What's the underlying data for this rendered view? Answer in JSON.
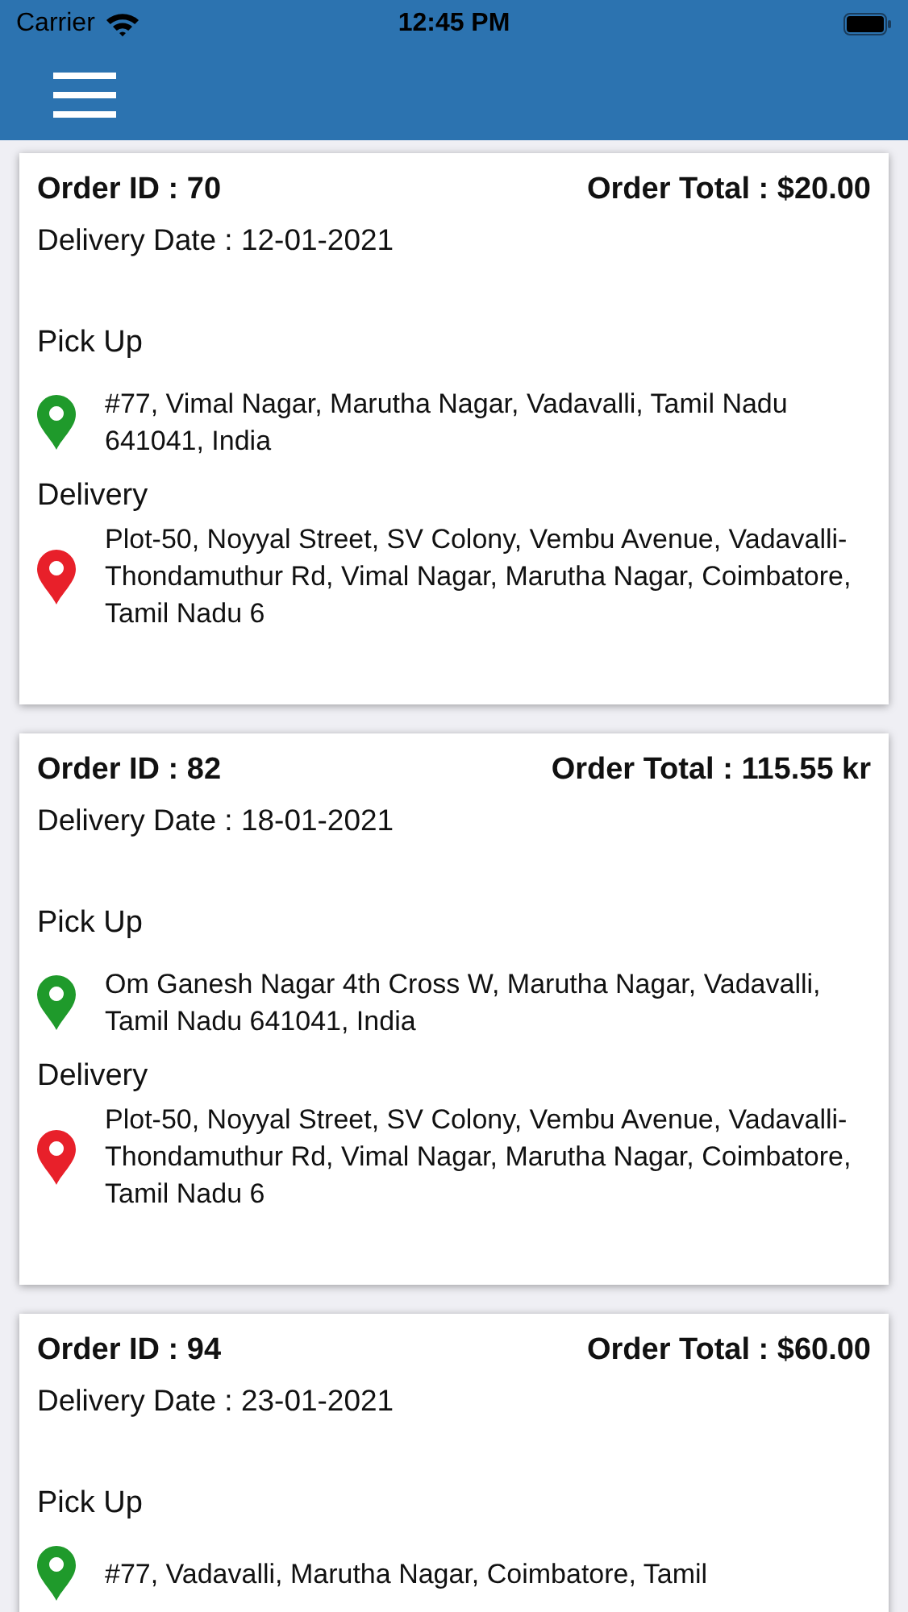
{
  "status_bar": {
    "carrier": "Carrier",
    "time": "12:45 PM"
  },
  "orders": [
    {
      "order_id": "Order ID : 70",
      "total": "Order Total : $20.00",
      "delivery_date": "Delivery Date : 12-01-2021",
      "locations": [
        {
          "kind": "pickup",
          "label": "Pick Up",
          "address": "#77, Vimal Nagar, Marutha Nagar, Vadavalli, Tamil Nadu 641041, India"
        },
        {
          "kind": "delivery",
          "label": "Delivery",
          "address": "Plot-50, Noyyal Street, SV Colony, Vembu Avenue, Vadavalli-Thondamuthur Rd, Vimal Nagar, Marutha Nagar, Coimbatore, Tamil Nadu 6"
        }
      ]
    },
    {
      "order_id": "Order ID : 82",
      "total": "Order Total : 115.55 kr",
      "delivery_date": "Delivery Date : 18-01-2021",
      "locations": [
        {
          "kind": "pickup",
          "label": "Pick Up",
          "address": "Om Ganesh Nagar 4th Cross W, Marutha Nagar, Vadavalli, Tamil Nadu 641041, India"
        },
        {
          "kind": "delivery",
          "label": "Delivery",
          "address": "Plot-50, Noyyal Street, SV Colony, Vembu Avenue, Vadavalli-Thondamuthur Rd, Vimal Nagar, Marutha Nagar, Coimbatore, Tamil Nadu 6"
        }
      ]
    },
    {
      "order_id": "Order ID : 94",
      "total": "Order Total : $60.00",
      "delivery_date": "Delivery Date : 23-01-2021",
      "locations": [
        {
          "kind": "pickup",
          "label": "Pick Up",
          "address": "#77, Vadavalli, Marutha Nagar, Coimbatore, Tamil"
        }
      ]
    }
  ]
}
